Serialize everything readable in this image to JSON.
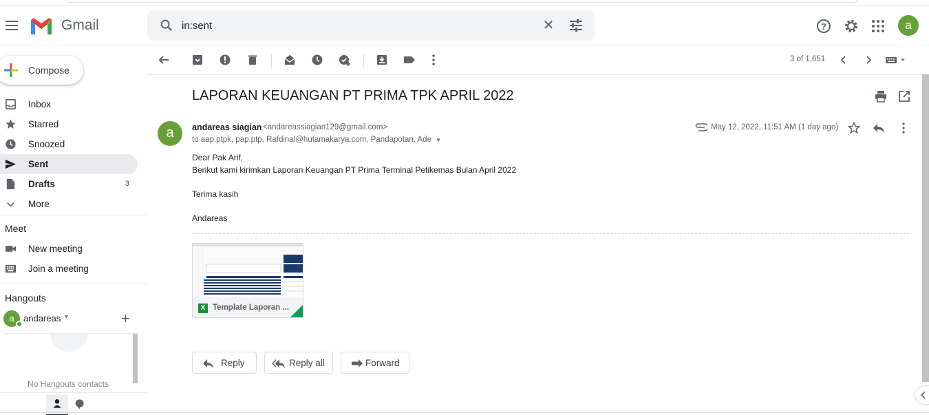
{
  "app": {
    "name": "Gmail"
  },
  "search": {
    "value": "in:sent",
    "clear_icon": "close-icon",
    "options_icon": "tune-icon"
  },
  "header_icons": [
    "help-icon",
    "settings-icon",
    "apps-icon"
  ],
  "account": {
    "initial": "a",
    "color": "#689f38"
  },
  "compose": {
    "label": "Compose"
  },
  "nav": [
    {
      "label": "Inbox",
      "icon": "inbox-icon",
      "count": ""
    },
    {
      "label": "Starred",
      "icon": "star-icon",
      "count": ""
    },
    {
      "label": "Snoozed",
      "icon": "clock-icon",
      "count": ""
    },
    {
      "label": "Sent",
      "icon": "send-icon",
      "count": "",
      "active": true
    },
    {
      "label": "Drafts",
      "icon": "draft-icon",
      "count": "3"
    },
    {
      "label": "More",
      "icon": "chevron-down-icon",
      "count": ""
    }
  ],
  "meet": {
    "title": "Meet",
    "items": [
      {
        "label": "New meeting",
        "icon": "video-icon"
      },
      {
        "label": "Join a meeting",
        "icon": "keyboard-icon"
      }
    ]
  },
  "hangouts": {
    "title": "Hangouts",
    "user": "andareas",
    "user_initial": "a",
    "empty_text": "No Hangouts contacts"
  },
  "toolbar": {
    "pager": "3 of 1,651"
  },
  "message": {
    "subject": "LAPORAN KEUANGAN PT PRIMA TPK APRIL 2022",
    "sender_initial": "a",
    "sender_name": "andareas siagian",
    "sender_email": "<andareassiagian129@gmail.com>",
    "recipients": "to aap.ptpk, pap.ptp, Rafdinal@hutamakarya.com, Pandapotan, Ade",
    "date": "May 12, 2022, 11:51 AM (1 day ago)",
    "body": [
      "Dear Pak Arif,",
      "Berikut kami kirimkan Laporan Keuangan PT Prima Terminal Petikemas Bulan April 2022",
      "Terima kasih",
      "Andareas"
    ],
    "attachment": {
      "name": "Template Laporan ...",
      "type_badge": "X"
    }
  },
  "actions": {
    "reply": "Reply",
    "reply_all": "Reply all",
    "forward": "Forward"
  }
}
